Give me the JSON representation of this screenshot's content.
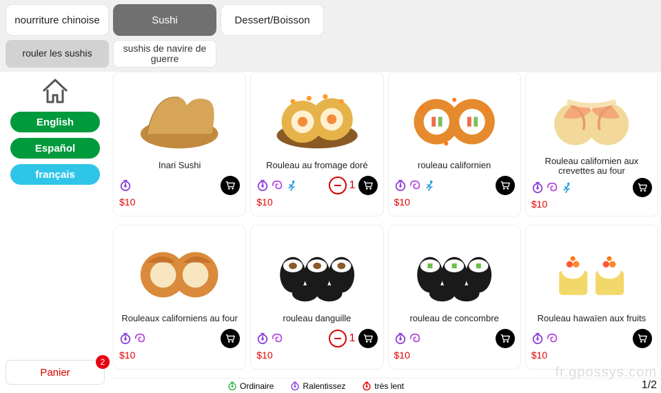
{
  "tabs": {
    "chinese": "nourriture chinoise",
    "sushi": "Sushi",
    "dessert": "Dessert/Boisson"
  },
  "subtabs": {
    "roll": "rouler les sushis",
    "warship": "sushis de navire de guerre"
  },
  "languages": {
    "en": "English",
    "es": "Español",
    "fr": "français"
  },
  "cart": {
    "label": "Panier",
    "count": "2"
  },
  "legend": {
    "ordinary": "Ordinaire",
    "slow": "Ralentissez",
    "veryslow": "très lent"
  },
  "pager": "1/2",
  "watermark": "fr.gpossys.com",
  "products": [
    {
      "name": "Inari Sushi",
      "price": "$10",
      "timer": true,
      "swirl": false,
      "runner": false,
      "qty": ""
    },
    {
      "name": "Rouleau au fromage doré",
      "price": "$10",
      "timer": true,
      "swirl": true,
      "runner": true,
      "qty": "1"
    },
    {
      "name": "rouleau californien",
      "price": "$10",
      "timer": true,
      "swirl": true,
      "runner": true,
      "qty": ""
    },
    {
      "name": "Rouleau californien aux crevettes au four",
      "price": "$10",
      "timer": true,
      "swirl": true,
      "runner": true,
      "qty": ""
    },
    {
      "name": "Rouleaux californiens au four",
      "price": "$10",
      "timer": true,
      "swirl": true,
      "runner": false,
      "qty": ""
    },
    {
      "name": "rouleau danguille",
      "price": "$10",
      "timer": true,
      "swirl": true,
      "runner": false,
      "qty": "1"
    },
    {
      "name": "rouleau de concombre",
      "price": "$10",
      "timer": true,
      "swirl": true,
      "runner": false,
      "qty": ""
    },
    {
      "name": "Rouleau hawaïen aux fruits",
      "price": "$10",
      "timer": true,
      "swirl": true,
      "runner": false,
      "qty": ""
    }
  ]
}
